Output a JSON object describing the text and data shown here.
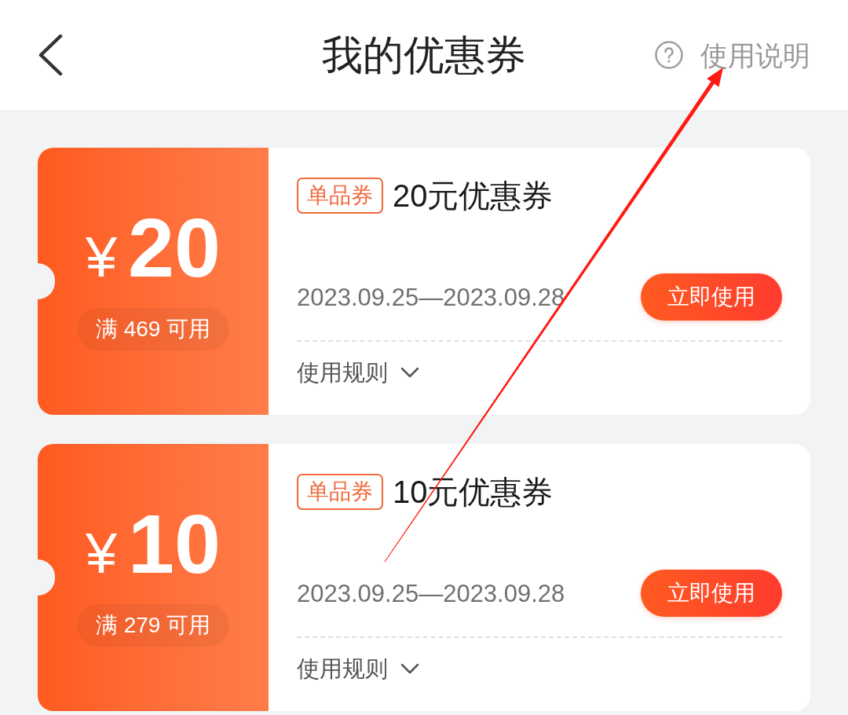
{
  "header": {
    "title": "我的优惠券",
    "help_link": "使用说明"
  },
  "coupons": [
    {
      "currency": "¥",
      "amount": "20",
      "condition": "满 469 可用",
      "tag": "单品券",
      "name": "20元优惠券",
      "validity": "2023.09.25—2023.09.28",
      "action": "立即使用",
      "rules_label": "使用规则",
      "rules_expanded": false
    },
    {
      "currency": "¥",
      "amount": "10",
      "condition": "满 279 可用",
      "tag": "单品券",
      "name": "10元优惠券",
      "validity": "2023.09.25—2023.09.28",
      "action": "立即使用",
      "rules_label": "使用规则",
      "rules_expanded": false
    }
  ]
}
